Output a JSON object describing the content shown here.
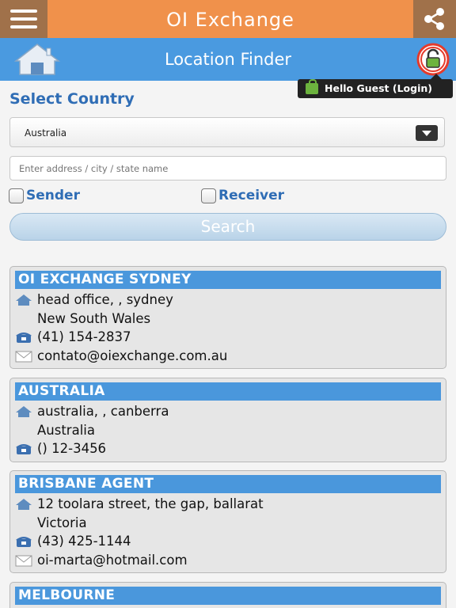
{
  "app": {
    "title": "OI Exchange"
  },
  "header": {
    "title": "Location Finder"
  },
  "guest": {
    "label": "Hello Guest (Login)"
  },
  "select_country": {
    "title": "Select Country",
    "value": "Australia"
  },
  "address": {
    "placeholder": "Enter address / city / state name"
  },
  "filters": {
    "sender": "Sender",
    "receiver": "Receiver"
  },
  "search_label": "Search",
  "locations": [
    {
      "name": "OI EXCHANGE SYDNEY",
      "address1": "head office, , sydney",
      "address2": "New South Wales",
      "phone": "(41) 154-2837",
      "email": "contato@oiexchange.com.au"
    },
    {
      "name": "AUSTRALIA",
      "address1": "australia, , canberra",
      "address2": "Australia",
      "phone": "() 12-3456"
    },
    {
      "name": "BRISBANE AGENT",
      "address1": "12 toolara street, the gap, ballarat",
      "address2": "Victoria",
      "phone": "(43) 425-1144",
      "email": "oi-marta@hotmail.com"
    },
    {
      "name": "MELBOURNE"
    }
  ],
  "colors": {
    "orange": "#f0914b",
    "blue": "#4a9ae0",
    "header_blue": "#4a97dc",
    "link_blue": "#2f6db5"
  }
}
